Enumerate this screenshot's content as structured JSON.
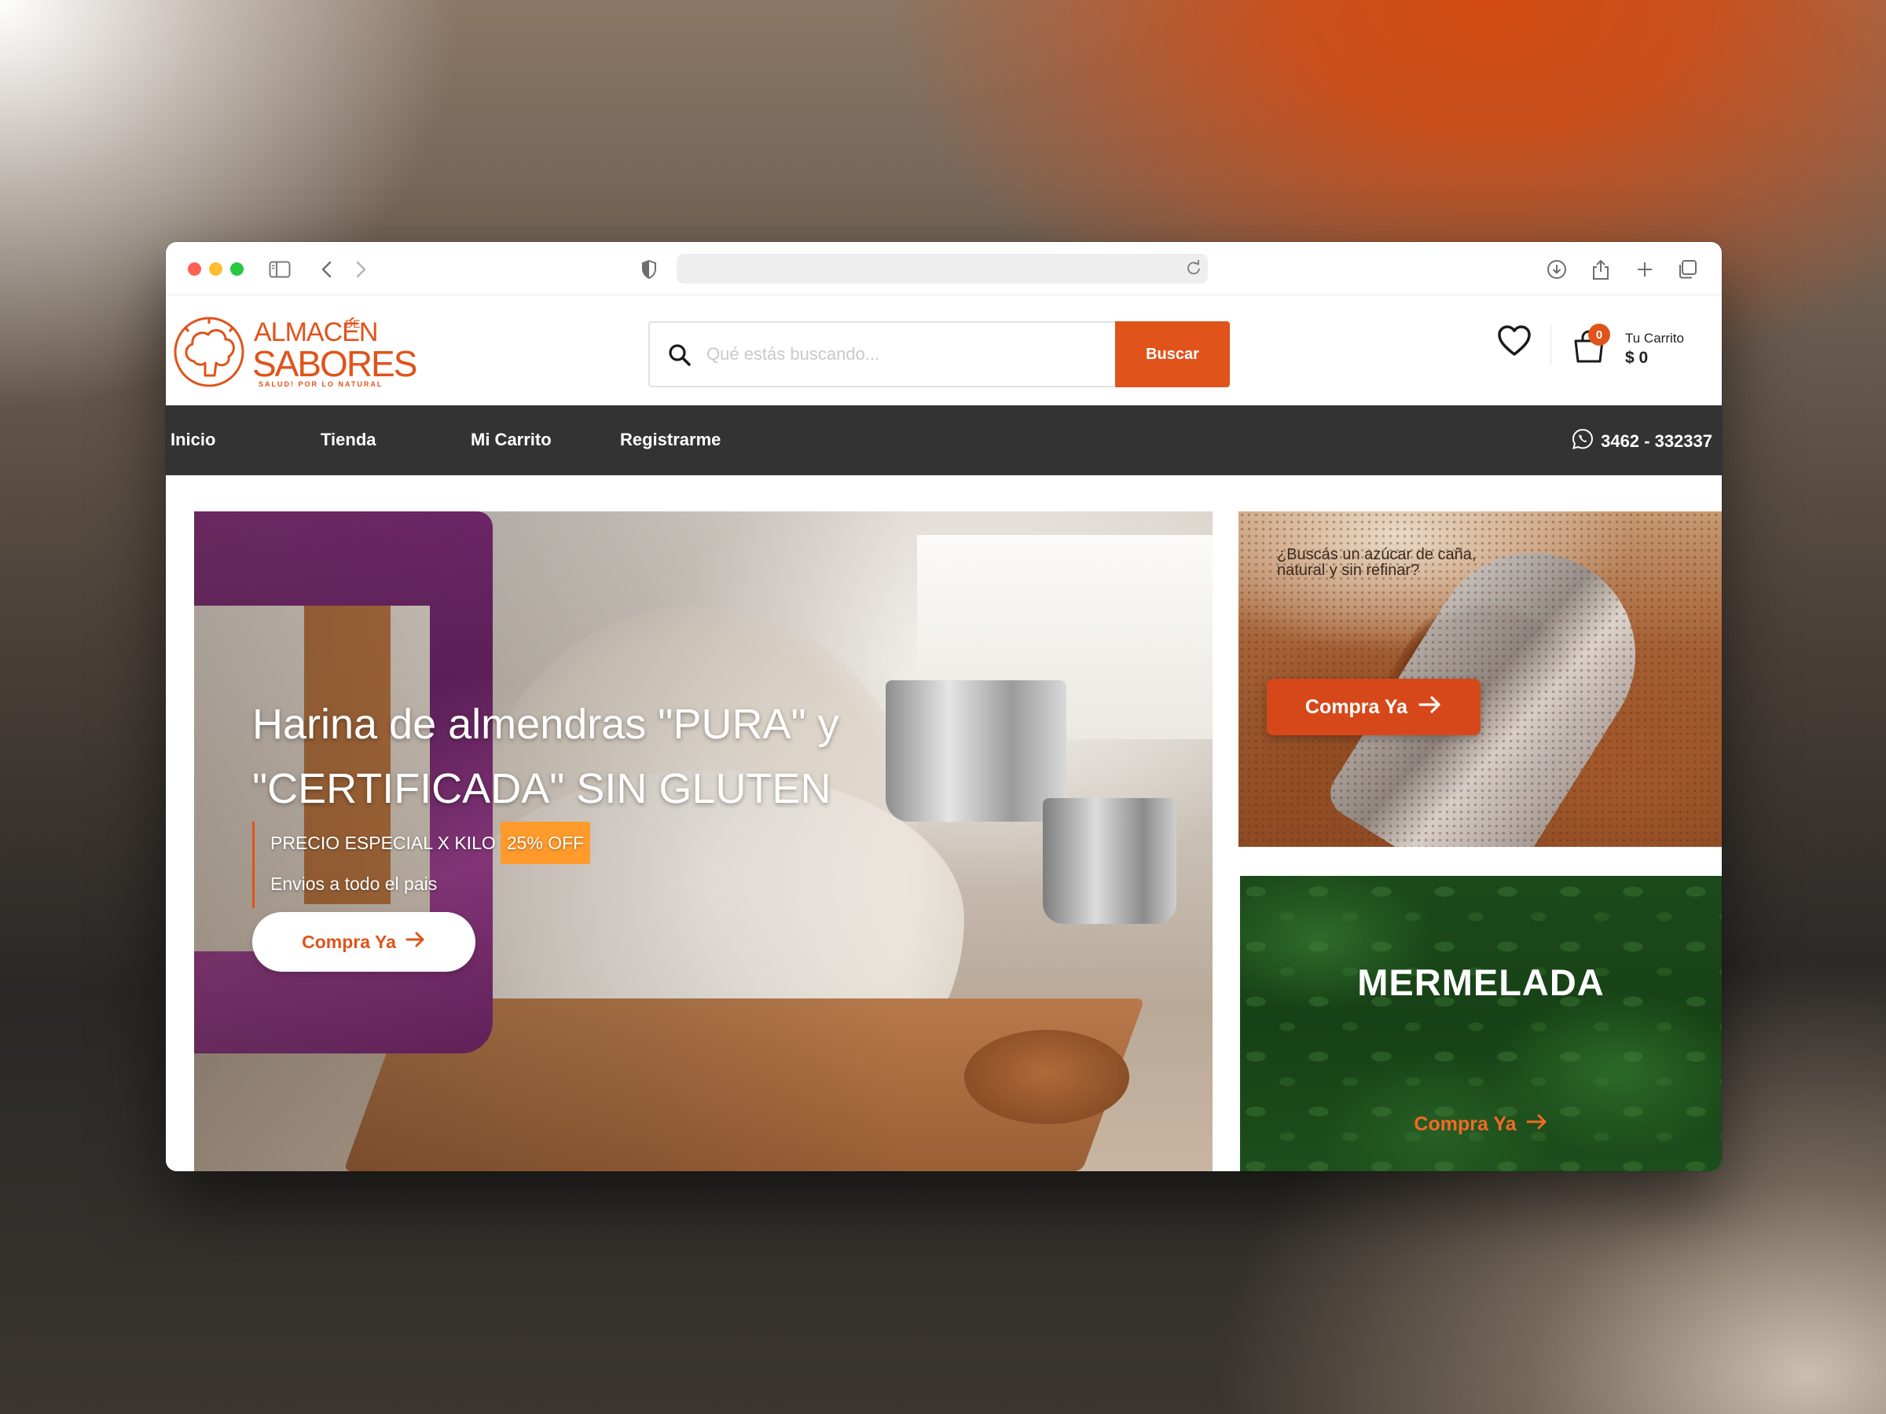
{
  "browser": {
    "address_value": ""
  },
  "brand": {
    "line1": "ALMACÉN",
    "de": "DE",
    "line2": "SABORES",
    "tagline": "SALUD! POR LO NATURAL"
  },
  "search": {
    "placeholder": "Qué estás buscando...",
    "button_label": "Buscar"
  },
  "cart": {
    "count": "0",
    "label": "Tu Carrito",
    "total": "$ 0"
  },
  "nav": {
    "items": [
      "Inicio",
      "Tienda",
      "Mi Carrito",
      "Registrarme"
    ],
    "phone": "3462 - 332337"
  },
  "hero": {
    "title_line1": "Harina de almendras \"PURA\" y",
    "title_line2": "\"CERTIFICADA\" SIN GLUTEN",
    "promo_text": "PRECIO ESPECIAL X KILO",
    "promo_badge": "25% OFF",
    "shipping_text": "Envios a todo el pais",
    "cta_label": "Compra Ya"
  },
  "promo_sugar": {
    "text": "¿Buscás un azúcar de caña, natural y sin refinar?",
    "cta_label": "Compra Ya"
  },
  "promo_jam": {
    "title": "MERMELADA",
    "cta_label": "Compra Ya"
  },
  "colors": {
    "accent": "#e0531b",
    "nav_bg": "#333333",
    "badge": "#ff9a2b"
  }
}
